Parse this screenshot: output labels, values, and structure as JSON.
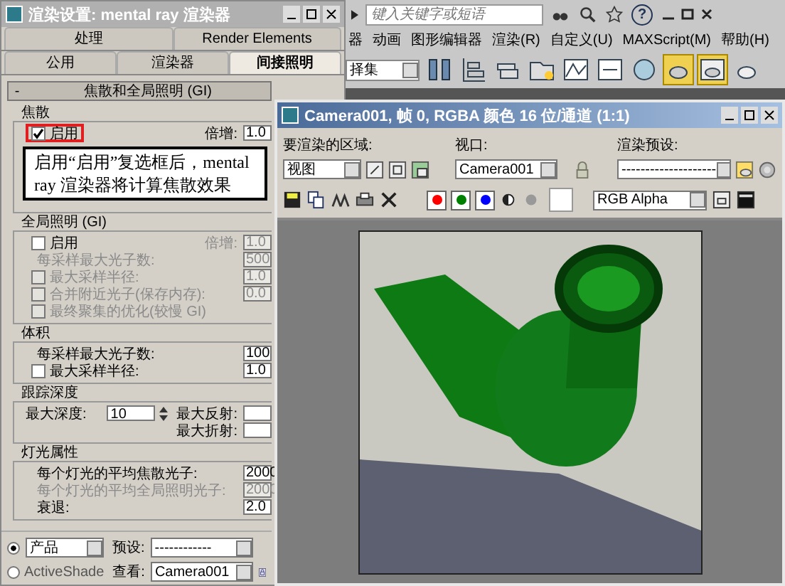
{
  "max_app": {
    "search_placeholder": "键入关键字或短语",
    "help": "?",
    "menu": [
      {
        "label": "器"
      },
      {
        "label": "动画"
      },
      {
        "label": "图形编辑器"
      },
      {
        "label": "渲染(R)"
      },
      {
        "label": "自定义(U)"
      },
      {
        "label": "MAXScript(M)"
      },
      {
        "label": "帮助(H)"
      }
    ],
    "selection_set": "择集"
  },
  "settings_dialog": {
    "title": "渲染设置: mental ray 渲染器",
    "tabs_row_1": [
      {
        "label": "处理",
        "selected": false
      },
      {
        "label": "Render Elements",
        "selected": false
      }
    ],
    "tabs_row_2": [
      {
        "label": "公用",
        "selected": false
      },
      {
        "label": "渲染器",
        "selected": false
      },
      {
        "label": "间接照明",
        "selected": true
      }
    ],
    "rollout": {
      "toggle": "-",
      "title": "焦散和全局照明 (GI)"
    },
    "groups": [
      {
        "title": "焦散",
        "rows": [
          {
            "kind": "check",
            "label": "启用",
            "checked": true,
            "highlighted": true,
            "disabled": false,
            "side_label": "倍增:",
            "side_disabled": false,
            "value": "1.0"
          }
        ]
      },
      {
        "title": "全局照明 (GI)",
        "rows": [
          {
            "kind": "check",
            "label": "启用",
            "checked": false,
            "highlighted": false,
            "disabled": false,
            "side_label": "倍增:",
            "side_disabled": true,
            "value": "1.0"
          },
          {
            "kind": "field",
            "label": "每采样最大光子数:",
            "disabled": true,
            "value": "500"
          },
          {
            "kind": "check",
            "label": "最大采样半径:",
            "checked": false,
            "highlighted": false,
            "disabled": true,
            "value": "1.0"
          },
          {
            "kind": "check",
            "label": "合并附近光子(保存内存):",
            "checked": false,
            "highlighted": false,
            "disabled": true,
            "value": "0.0"
          },
          {
            "kind": "check",
            "label": "最终聚集的优化(较慢 GI)",
            "checked": false,
            "highlighted": false,
            "disabled": true
          }
        ]
      },
      {
        "title": "体积",
        "rows": [
          {
            "kind": "field",
            "label": "每采样最大光子数:",
            "disabled": false,
            "value": "100"
          },
          {
            "kind": "check",
            "label": "最大采样半径:",
            "checked": false,
            "highlighted": false,
            "disabled": false,
            "value": "1.0"
          }
        ]
      },
      {
        "title": "跟踪深度",
        "rows": [
          {
            "kind": "spinner",
            "label": "最大深度:",
            "disabled": false,
            "value": "10",
            "side_label": "最大反射:"
          },
          {
            "kind": "side",
            "disabled": false,
            "side_label": "最大折射:"
          }
        ]
      },
      {
        "title": "灯光属性",
        "rows": [
          {
            "kind": "field",
            "label": "每个灯光的平均焦散光子:",
            "disabled": false,
            "value": "2000"
          },
          {
            "kind": "field",
            "label": "每个灯光的平均全局照明光子:",
            "disabled": true,
            "value": "2000"
          },
          {
            "kind": "field",
            "label": "衰退:",
            "disabled": false,
            "value": "2.0"
          }
        ]
      }
    ],
    "callout": "启用“启用”复选框后，mental ray 渲染器将计算焦散效果",
    "modes": [
      {
        "selected": true,
        "dropdown": "产品"
      },
      {
        "selected": false,
        "label": "ActiveShade"
      }
    ],
    "preset_label": "预设:",
    "preset_value": "------------",
    "view_label": "查看:",
    "view_value": "Camera001"
  },
  "render_frame": {
    "title": "Camera001, 帧 0, RGBA 颜色 16 位/通道 (1:1)",
    "area_label": "要渲染的区域:",
    "area_value": "视图",
    "viewport_label": "视口:",
    "viewport_value": "Camera001",
    "preset_label": "渲染预设:",
    "preset_value": "--------------------",
    "channels": [
      {
        "color": "#ff0000",
        "on": true
      },
      {
        "color": "#008000",
        "on": true
      },
      {
        "color": "#0000ff",
        "on": true
      }
    ],
    "channel_display": "RGB Alpha"
  }
}
